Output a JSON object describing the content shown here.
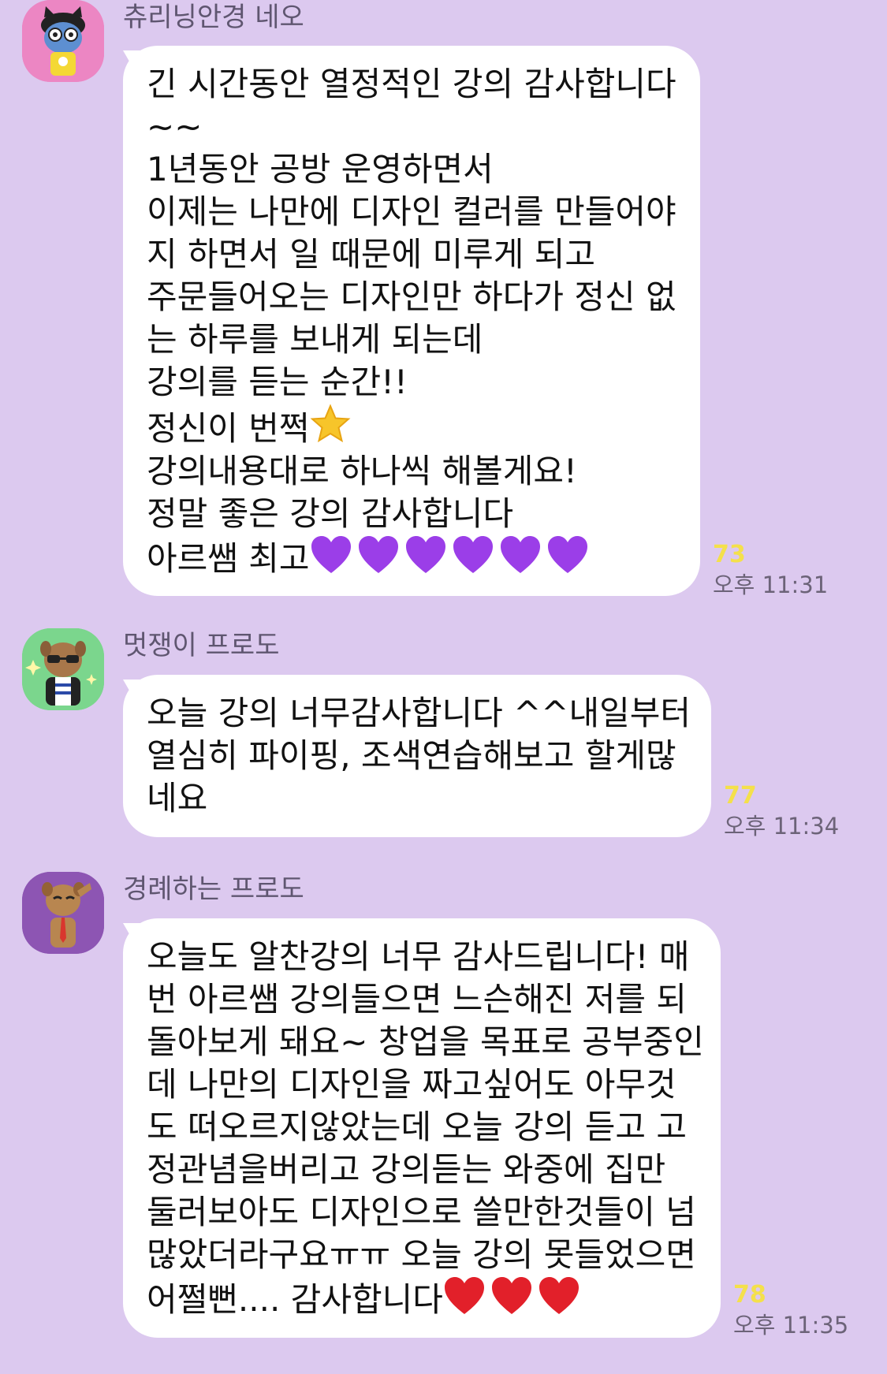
{
  "chat": {
    "messages": [
      {
        "sender": "츄리닝안경 네오",
        "lines": [
          "긴 시간동안 열정적인 강의 감사합니다",
          "~~",
          "1년동안 공방 운영하면서",
          "이제는 나만에 디자인 컬러를 만들어야",
          "지 하면서 일 때문에 미루게 되고",
          "주문들어오는 디자인만 하다가 정신 없",
          "는 하루를 보내게 되는데",
          "강의를 듣는 순간!!",
          "정신이 번쩍",
          "강의내용대로 하나씩 해볼게요!",
          "정말 좋은 강의 감사합니다",
          "아르쌤 최고"
        ],
        "emoji_star": "star-emoji",
        "emoji_hearts": "purple-heart-emoji",
        "unread_count": "73",
        "time": "오후 11:31",
        "avatar_icon": "neo-avatar-icon",
        "avatar_bg": "#ec86c3"
      },
      {
        "sender": "멋쟁이 프로도",
        "lines": [
          "오늘 강의 너무감사합니다 ^^내일부터",
          "열심히 파이핑, 조색연습해보고 할게많",
          "네요"
        ],
        "unread_count": "77",
        "time": "오후 11:34",
        "avatar_icon": "frodo-cool-avatar-icon",
        "avatar_bg": "#7bd68d"
      },
      {
        "sender": "경례하는 프로도",
        "lines": [
          "오늘도 알찬강의 너무 감사드립니다! 매",
          "번 아르쌤 강의들으면 느슨해진 저를 되",
          "돌아보게 돼요~ 창업을 목표로 공부중인",
          "데 나만의 디자인을 짜고싶어도 아무것",
          "도 떠오르지않았는데 오늘 강의 듣고 고",
          "정관념을버리고 강의듣는 와중에 집만",
          "둘러보아도 디자인으로 쓸만한것들이 넘",
          "많았더라구요ㅠㅠ 오늘 강의 못들었으면",
          "어쩔뻔.... 감사합니다"
        ],
        "emoji_hearts": "red-heart-emoji",
        "unread_count": "78",
        "time": "오후 11:35",
        "avatar_icon": "frodo-salute-avatar-icon",
        "avatar_bg": "#8d55b3"
      }
    ]
  },
  "colors": {
    "background": "#dcc9ef",
    "bubble": "#ffffff",
    "unread": "#f4e04b",
    "purple_heart": "#9b3ee8",
    "red_heart": "#e2202a",
    "star": "#f7c52a"
  }
}
